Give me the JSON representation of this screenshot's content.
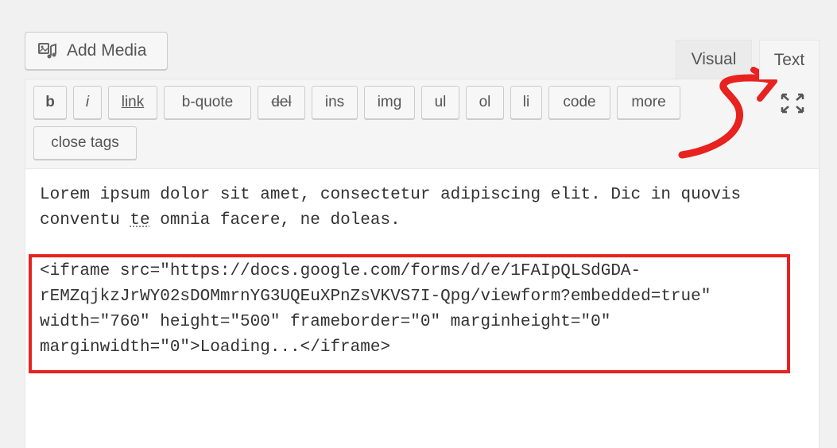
{
  "toolbar": {
    "add_media_label": "Add Media",
    "add_media_icon": "media-icon"
  },
  "tabs": {
    "visual_label": "Visual",
    "text_label": "Text",
    "active": "Text"
  },
  "quicktags": [
    {
      "label": "b"
    },
    {
      "label": "i"
    },
    {
      "label": "link"
    },
    {
      "label": "b-quote"
    },
    {
      "label": "del"
    },
    {
      "label": "ins"
    },
    {
      "label": "img"
    },
    {
      "label": "ul"
    },
    {
      "label": "ol"
    },
    {
      "label": "li"
    },
    {
      "label": "code"
    },
    {
      "label": "more"
    },
    {
      "label": "close tags"
    }
  ],
  "fullscreen_icon": "fullscreen-icon",
  "content": {
    "line1": "Lorem ipsum dolor sit amet, consectetur adipiscing elit. Dic in quovis",
    "line2_a": "conventu ",
    "line2_b": "te",
    "line2_c": " omnia facere, ne doleas.",
    "code_line1": "<iframe src=\"https://docs.google.com/forms/d/e/1FAIpQLSdGDA-",
    "code_line2": "rEMZqjkzJrWY02sDOMmrnYG3UQEuXPnZsVKVS7I-Qpg/viewform?embedded=true\"",
    "code_line3": "width=\"760\" height=\"500\" frameborder=\"0\" marginheight=\"0\"",
    "code_line4": "marginwidth=\"0\">Loading...</iframe>"
  },
  "colors": {
    "highlight": "#e8221f",
    "annotation_arrow": "#e8221f"
  }
}
